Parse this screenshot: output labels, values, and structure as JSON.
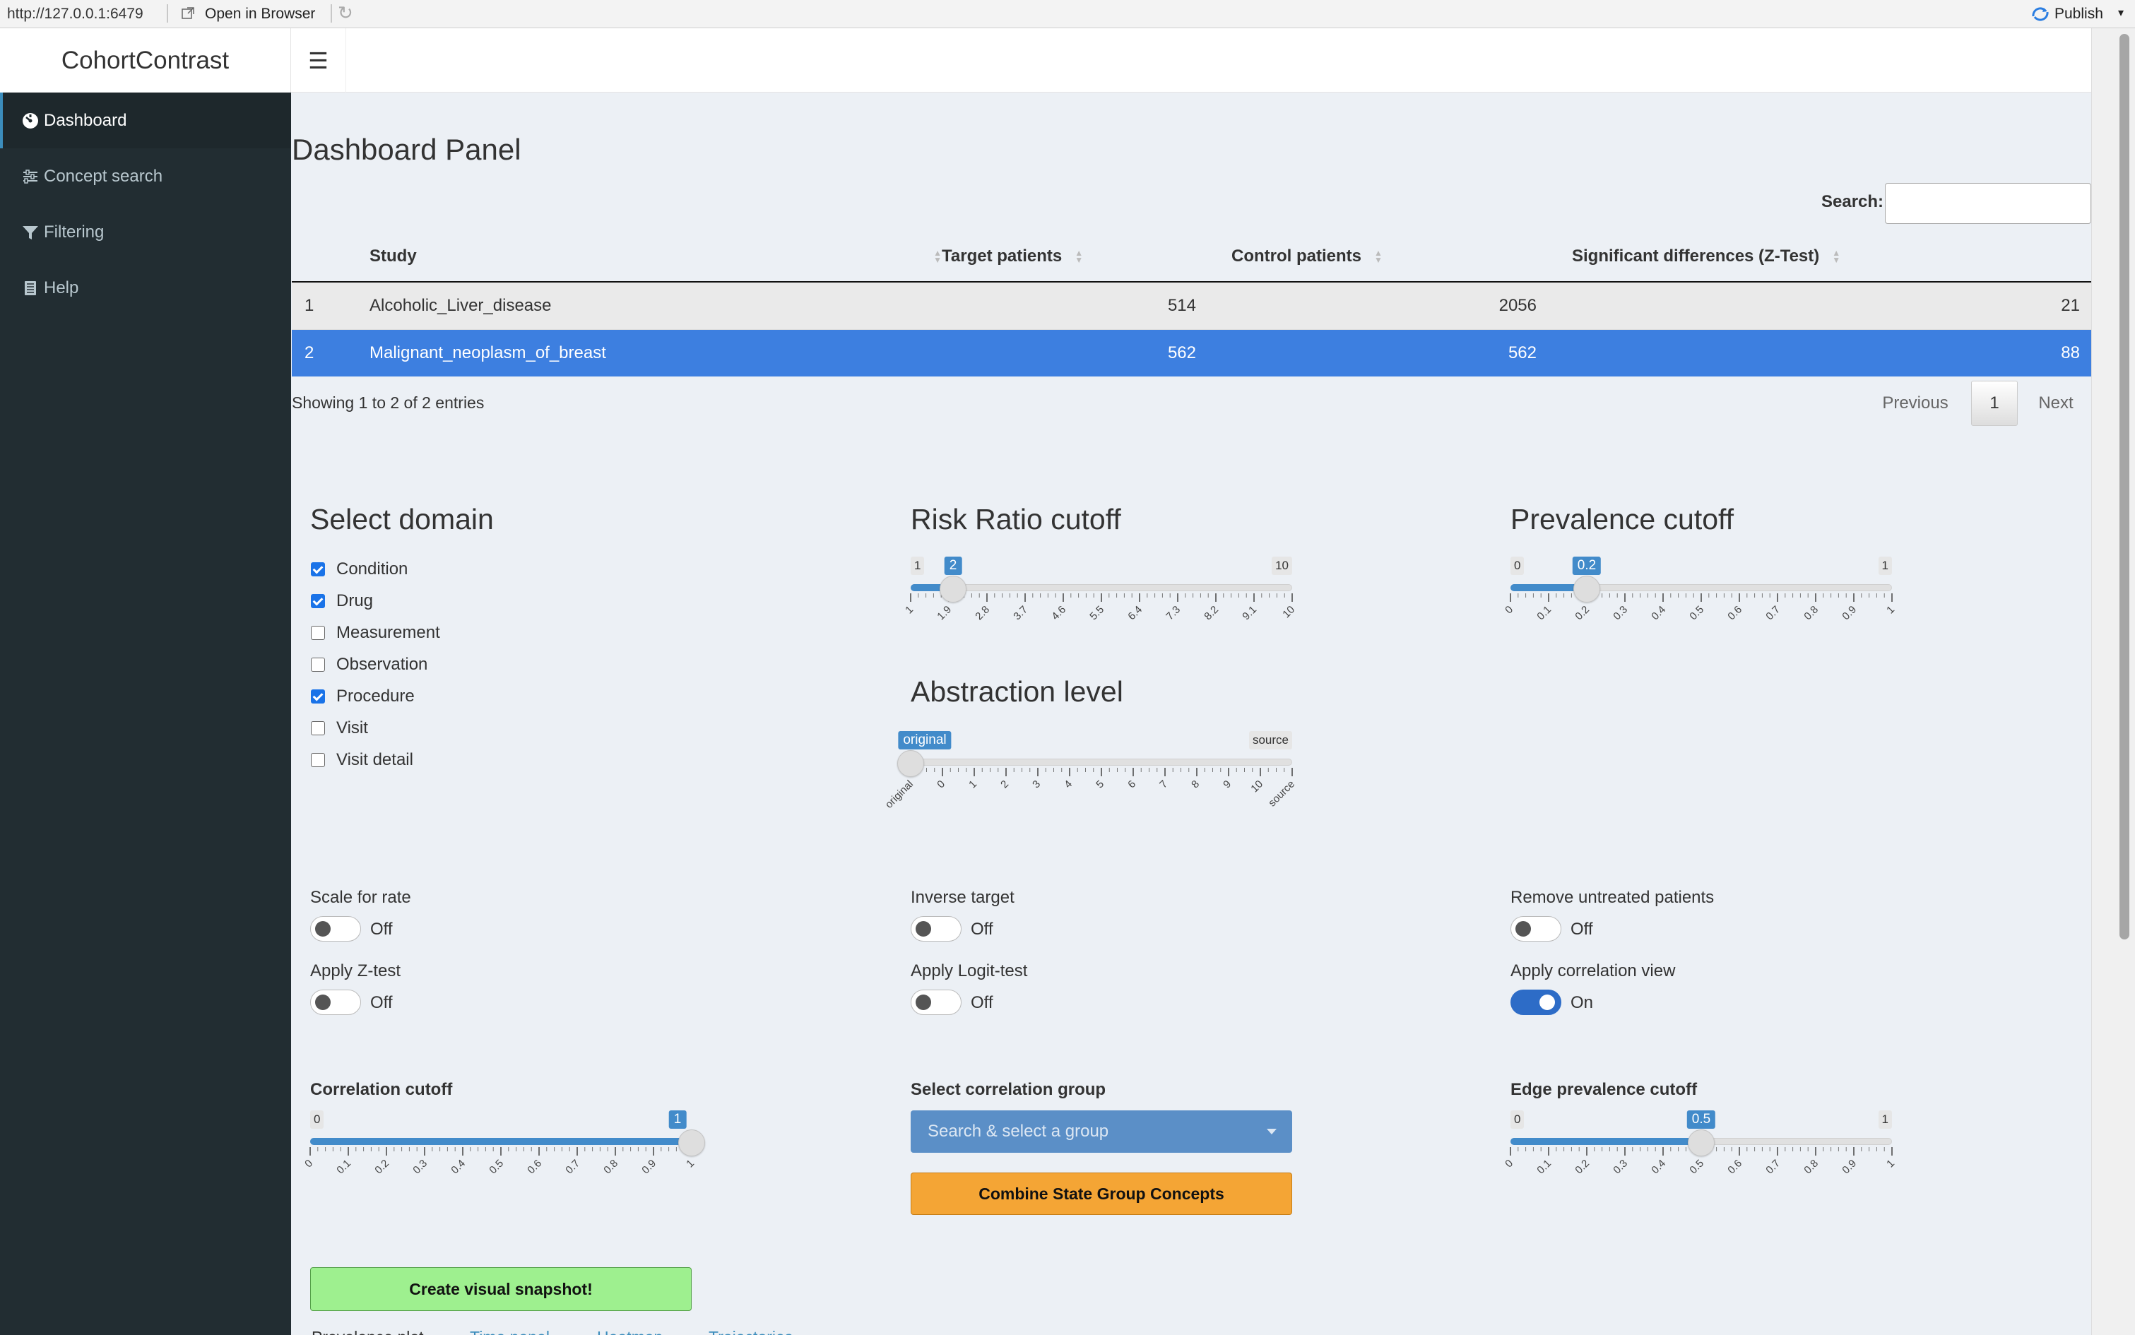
{
  "viewer": {
    "url": "http://127.0.0.1:6479",
    "open_label": "Open in Browser",
    "publish_label": "Publish"
  },
  "app": {
    "title": "CohortContrast"
  },
  "sidebar": {
    "items": [
      {
        "label": "Dashboard",
        "icon": "dashboard-icon"
      },
      {
        "label": "Concept search",
        "icon": "sliders-icon"
      },
      {
        "label": "Filtering",
        "icon": "filter-icon"
      },
      {
        "label": "Help",
        "icon": "book-icon"
      }
    ]
  },
  "page": {
    "title": "Dashboard Panel"
  },
  "table": {
    "search_label": "Search:",
    "columns": [
      "",
      "Study",
      "Target patients",
      "Control patients",
      "Significant differences (Z-Test)"
    ],
    "rows": [
      {
        "idx": "1",
        "study": "Alcoholic_Liver_disease",
        "target": "514",
        "control": "2056",
        "sig": "21"
      },
      {
        "idx": "2",
        "study": "Malignant_neoplasm_of_breast",
        "target": "562",
        "control": "562",
        "sig": "88"
      }
    ],
    "selected_row": 2,
    "info": "Showing 1 to 2 of 2 entries",
    "previous": "Previous",
    "page": "1",
    "next": "Next"
  },
  "domain": {
    "title": "Select domain",
    "options": [
      {
        "label": "Condition",
        "checked": true
      },
      {
        "label": "Drug",
        "checked": true
      },
      {
        "label": "Measurement",
        "checked": false
      },
      {
        "label": "Observation",
        "checked": false
      },
      {
        "label": "Procedure",
        "checked": true
      },
      {
        "label": "Visit",
        "checked": false
      },
      {
        "label": "Visit detail",
        "checked": false
      }
    ]
  },
  "risk_ratio": {
    "title": "Risk Ratio cutoff",
    "min": "1",
    "max": "10",
    "value": "2",
    "value_num": 2,
    "min_num": 1,
    "max_num": 10,
    "ticks": [
      "1",
      "1.9",
      "2.8",
      "3.7",
      "4.6",
      "5.5",
      "6.4",
      "7.3",
      "8.2",
      "9.1",
      "10"
    ]
  },
  "prevalence": {
    "title": "Prevalence cutoff",
    "min": "0",
    "max": "1",
    "value": "0.2",
    "value_num": 0.2,
    "min_num": 0,
    "max_num": 1,
    "ticks": [
      "0",
      "0.1",
      "0.2",
      "0.3",
      "0.4",
      "0.5",
      "0.6",
      "0.7",
      "0.8",
      "0.9",
      "1"
    ]
  },
  "abstraction": {
    "title": "Abstraction level",
    "min": "original",
    "max": "source",
    "value": "original",
    "value_index": 0,
    "ticks": [
      "original",
      "0",
      "1",
      "2",
      "3",
      "4",
      "5",
      "6",
      "7",
      "8",
      "9",
      "10",
      "source"
    ]
  },
  "toggles": {
    "scale_rate": {
      "label": "Scale for rate",
      "state": "Off",
      "on": false
    },
    "inverse_target": {
      "label": "Inverse target",
      "state": "Off",
      "on": false
    },
    "remove_untreated": {
      "label": "Remove untreated patients",
      "state": "Off",
      "on": false
    },
    "z_test": {
      "label": "Apply Z-test",
      "state": "Off",
      "on": false
    },
    "logit_test": {
      "label": "Apply Logit-test",
      "state": "Off",
      "on": false
    },
    "correlation_view": {
      "label": "Apply correlation view",
      "state": "On",
      "on": true
    }
  },
  "correlation_cutoff": {
    "title": "Correlation cutoff",
    "min": "0",
    "value": "1",
    "value_num": 1,
    "min_num": 0,
    "max_num": 1,
    "ticks": [
      "0",
      "0.1",
      "0.2",
      "0.3",
      "0.4",
      "0.5",
      "0.6",
      "0.7",
      "0.8",
      "0.9",
      "1"
    ]
  },
  "correlation_group": {
    "title": "Select correlation group",
    "placeholder": "Search & select a group",
    "combine_button": "Combine State Group Concepts"
  },
  "edge_prevalence": {
    "title": "Edge prevalence cutoff",
    "min": "0",
    "max": "1",
    "value": "0.5",
    "value_num": 0.5,
    "min_num": 0,
    "max_num": 1,
    "ticks": [
      "0",
      "0.1",
      "0.2",
      "0.3",
      "0.4",
      "0.5",
      "0.6",
      "0.7",
      "0.8",
      "0.9",
      "1"
    ]
  },
  "snapshot_button": "Create visual snapshot!",
  "tabs": [
    "Prevalence plot",
    "Time panel",
    "Heatmap",
    "Trajectories"
  ],
  "colors": {
    "accent": "#428bca",
    "selected_row": "#3d7fe0",
    "sidebar": "#222d32",
    "orange": "#f4a535",
    "green": "#9ef08f"
  }
}
